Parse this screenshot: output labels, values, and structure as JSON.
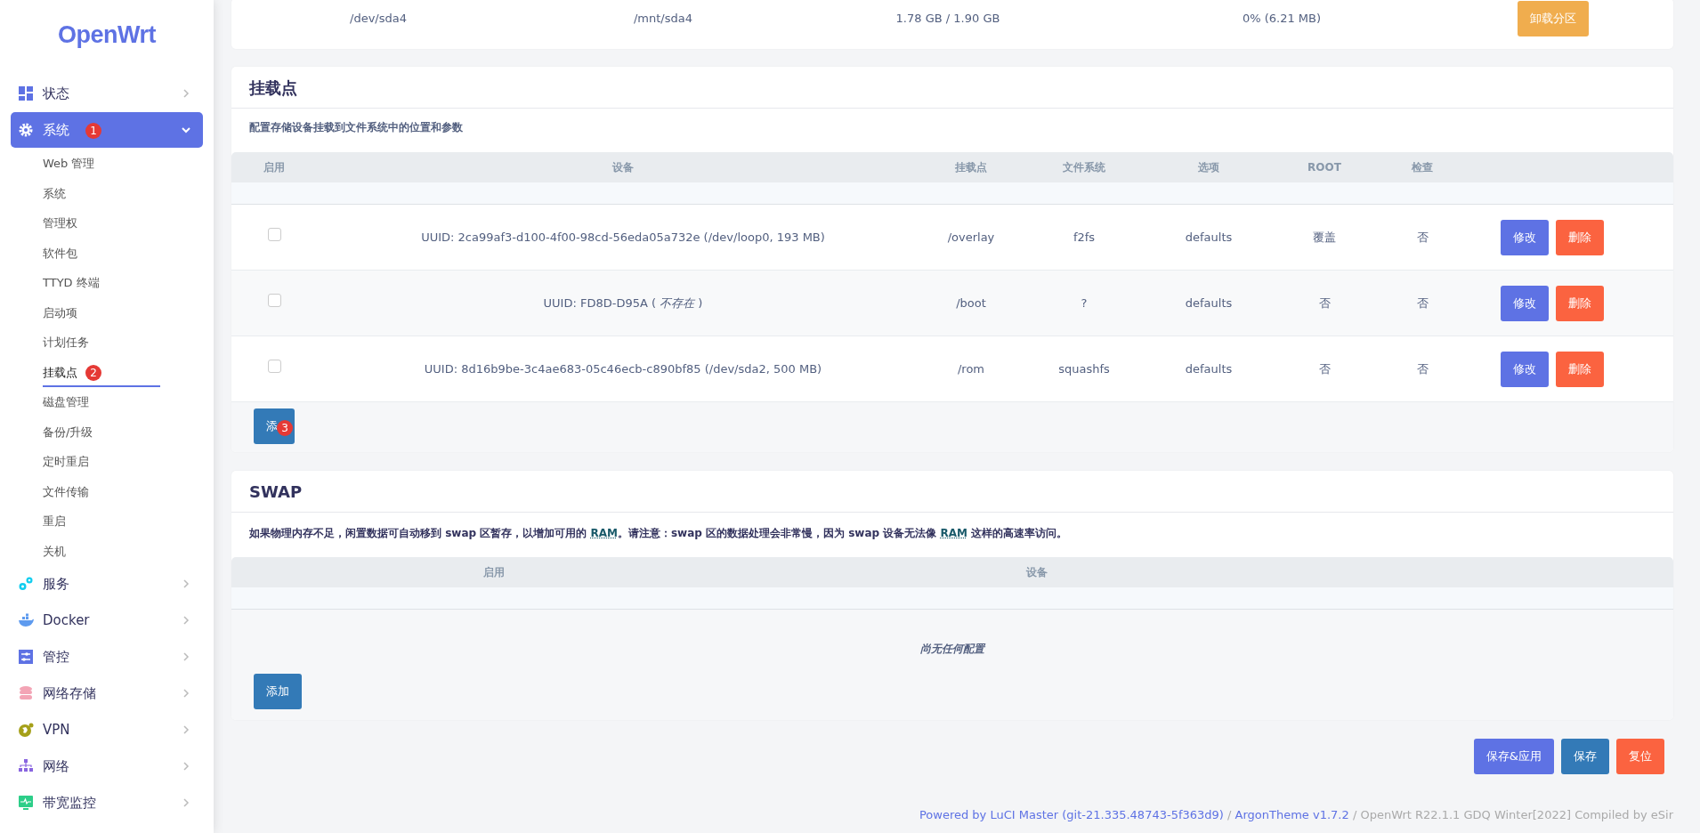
{
  "sidebar": {
    "logo": "OpenWrt",
    "items": [
      {
        "label": "状态",
        "expanded": false,
        "selected": false
      },
      {
        "label": "系统",
        "expanded": true,
        "selected": true,
        "badge": "1",
        "children": [
          {
            "label": "Web 管理",
            "selected": false
          },
          {
            "label": "系统",
            "selected": false
          },
          {
            "label": "管理权",
            "selected": false
          },
          {
            "label": "软件包",
            "selected": false
          },
          {
            "label": "TTYD 终端",
            "selected": false
          },
          {
            "label": "启动项",
            "selected": false
          },
          {
            "label": "计划任务",
            "selected": false
          },
          {
            "label": "挂载点",
            "selected": true,
            "badge": "2"
          },
          {
            "label": "磁盘管理",
            "selected": false
          },
          {
            "label": "备份/升级",
            "selected": false
          },
          {
            "label": "定时重启",
            "selected": false
          },
          {
            "label": "文件传输",
            "selected": false
          },
          {
            "label": "重启",
            "selected": false
          },
          {
            "label": "关机",
            "selected": false
          }
        ]
      },
      {
        "label": "服务",
        "expanded": false,
        "selected": false
      },
      {
        "label": "Docker",
        "expanded": false,
        "selected": false
      },
      {
        "label": "管控",
        "expanded": false,
        "selected": false
      },
      {
        "label": "网络存储",
        "expanded": false,
        "selected": false
      },
      {
        "label": "VPN",
        "expanded": false,
        "selected": false
      },
      {
        "label": "网络",
        "expanded": false,
        "selected": false
      },
      {
        "label": "带宽监控",
        "expanded": false,
        "selected": false
      }
    ]
  },
  "mounted_row": {
    "cells": [
      "/dev/sda4",
      "/mnt/sda4",
      "1.78 GB / 1.90 GB",
      "0% (6.21 MB)"
    ],
    "button": "卸载分区"
  },
  "mount_points": {
    "title": "挂载点",
    "description": "配置存储设备挂载到文件系统中的位置和参数",
    "columns": [
      "启用",
      "设备",
      "挂载点",
      "文件系统",
      "选项",
      "ROOT",
      "检查"
    ],
    "rows": [
      {
        "checked": false,
        "device": "UUID: 2ca99af3-d100-4f00-98cd-56eda05a732e (/dev/loop0, 193 MB)",
        "mount": "/overlay",
        "fs": "f2fs",
        "options": "defaults",
        "root": "覆盖",
        "check": "否",
        "edit": "修改",
        "delete": "删除"
      },
      {
        "checked": false,
        "device": "UUID: FD8D-D95A ( *不存在* )",
        "mount": "/boot",
        "fs": "?",
        "options": "defaults",
        "root": "否",
        "check": "否",
        "edit": "修改",
        "delete": "删除"
      },
      {
        "checked": false,
        "device": "UUID: 8d16b9be-3c4ae683-05c46ecb-c890bf85 (/dev/sda2, 500 MB)",
        "mount": "/rom",
        "fs": "squashfs",
        "options": "defaults",
        "root": "否",
        "check": "否",
        "edit": "修改",
        "delete": "删除"
      }
    ],
    "add_button": {
      "label": "添",
      "badge": "3"
    }
  },
  "swap": {
    "title": "SWAP",
    "description": [
      {
        "kind": "text",
        "text": "如果物理内存不足，闲置数据可自动移到 swap 区暂存，以增加可用的 "
      },
      {
        "kind": "abbr",
        "text": "RAM"
      },
      {
        "kind": "text",
        "text": "。请注意：swap 区的数据处理会非常慢，因为 swap 设备无法像 "
      },
      {
        "kind": "abbr",
        "text": "RAM"
      },
      {
        "kind": "text",
        "text": " 这样的高速率访问。"
      }
    ],
    "columns": [
      "启用",
      "设备"
    ],
    "empty_text": "尚无任何配置",
    "add_button": {
      "label": "添加"
    }
  },
  "actions": [
    {
      "label": "保存&应用",
      "kind": "primary"
    },
    {
      "label": "保存",
      "kind": "save"
    },
    {
      "label": "复位",
      "kind": "reset"
    }
  ],
  "footer": [
    {
      "kind": "link",
      "text": "Powered by LuCI Master (git-21.335.48743-5f363d9)"
    },
    {
      "kind": "text",
      "text": " / "
    },
    {
      "kind": "link",
      "text": "ArgonTheme v1.7.2"
    },
    {
      "kind": "text",
      "text": " / OpenWrt R22.1.1 GDQ Winter[2022] Compiled by eSir"
    }
  ]
}
